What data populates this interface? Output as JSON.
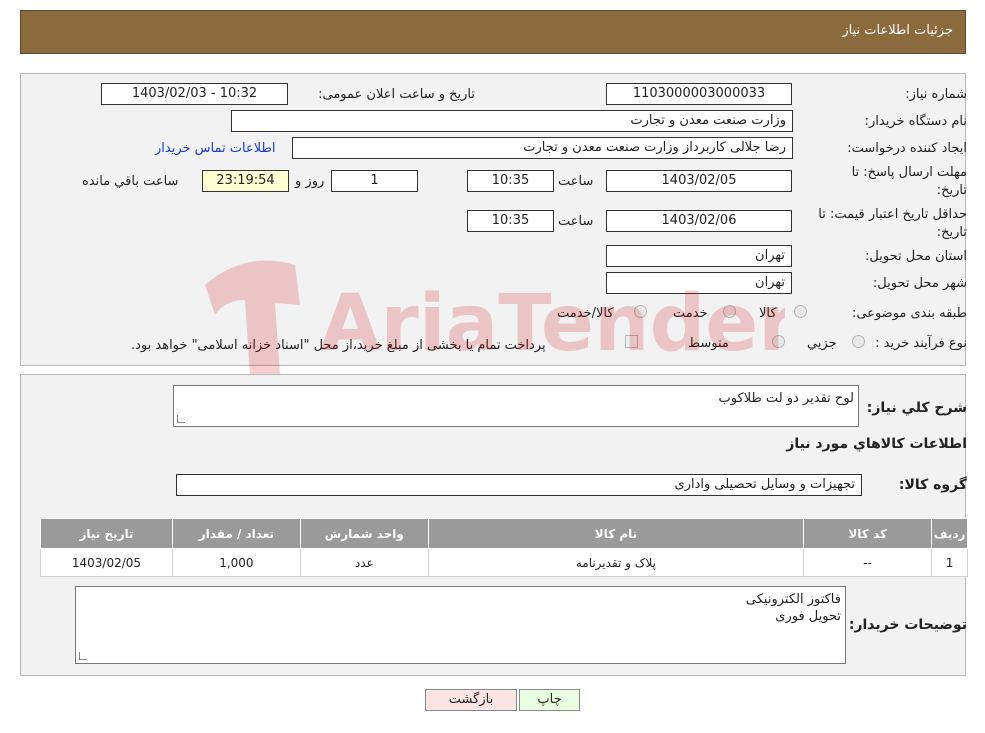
{
  "header": {
    "title": "جزئیات اطلاعات نیاز"
  },
  "form": {
    "need_number_label": "شماره نیاز:",
    "need_number": "1103000003000033",
    "announce_label": "تاریخ و ساعت اعلان عمومی:",
    "announce_value": "1403/02/03 - 10:32",
    "buyer_org_label": "نام دستگاه خریدار:",
    "buyer_org": "وزارت صنعت معدن و تجارت",
    "creator_label": "ایجاد کننده درخواست:",
    "creator": "رضا جلالی کاربرداز وزارت صنعت معدن و تجارت",
    "contact_link": "اطلاعات تماس خریدار",
    "deadline_label_1": "مهلت ارسال پاسخ: تا",
    "deadline_label_2": "تاریخ:",
    "deadline_date": "1403/02/05",
    "time_label": "ساعت",
    "deadline_time": "10:35",
    "days_value": "1",
    "days_label": "روز و",
    "remaining_time": "23:19:54",
    "remaining_label": "ساعت باقي مانده",
    "validity_label_1": "حداقل تاریخ اعتبار قیمت: تا",
    "validity_label_2": "تاریخ:",
    "validity_date": "1403/02/06",
    "validity_time": "10:35",
    "province_label": "استان محل تحویل:",
    "province": "تهران",
    "city_label": "شهر محل تحویل:",
    "city": "تهران",
    "category_label": "طبقه بندی موضوعی:",
    "category_options": [
      "کالا",
      "خدمت",
      "کالا/خدمت"
    ],
    "process_label": "نوع فرآیند خرید :",
    "process_options": [
      "جزیي",
      "متوسط"
    ],
    "payment_note": "پرداخت تمام یا بخشی از مبلغ خرید،از محل \"اسناد خزانه اسلامی\" خواهد بود."
  },
  "details": {
    "summary_label": "شرح کلي نياز:",
    "summary": "لوح تقدیر دو لت طلاکوب",
    "goods_info_title": "اطلاعات کالاهاي مورد نياز",
    "goods_group_label": "گروه کالا:",
    "goods_group": "تجهیزات و وسایل تحصیلی واداری",
    "table": {
      "headers": [
        "رديف",
        "کد کالا",
        "نام کالا",
        "واحد شمارش",
        "تعداد / مقدار",
        "تاریخ نیاز"
      ],
      "rows": [
        [
          "1",
          "--",
          "پلاک و تقدیرنامه",
          "عدد",
          "1,000",
          "1403/02/05"
        ]
      ]
    },
    "buyer_notes_label": "توضیحات خریدار:",
    "buyer_notes_line1": "فاکتور الکترونیکی",
    "buyer_notes_line2": "تحویل فوری"
  },
  "buttons": {
    "print": "چاپ",
    "back": "بازگشت"
  },
  "watermark": {
    "text": "AriaTender.neT"
  },
  "colors": {
    "header_bg": "#8b6a3e",
    "link": "#1a3ccf",
    "back_bg": "#ffe4e4",
    "print_bg": "#e8ffe0"
  }
}
